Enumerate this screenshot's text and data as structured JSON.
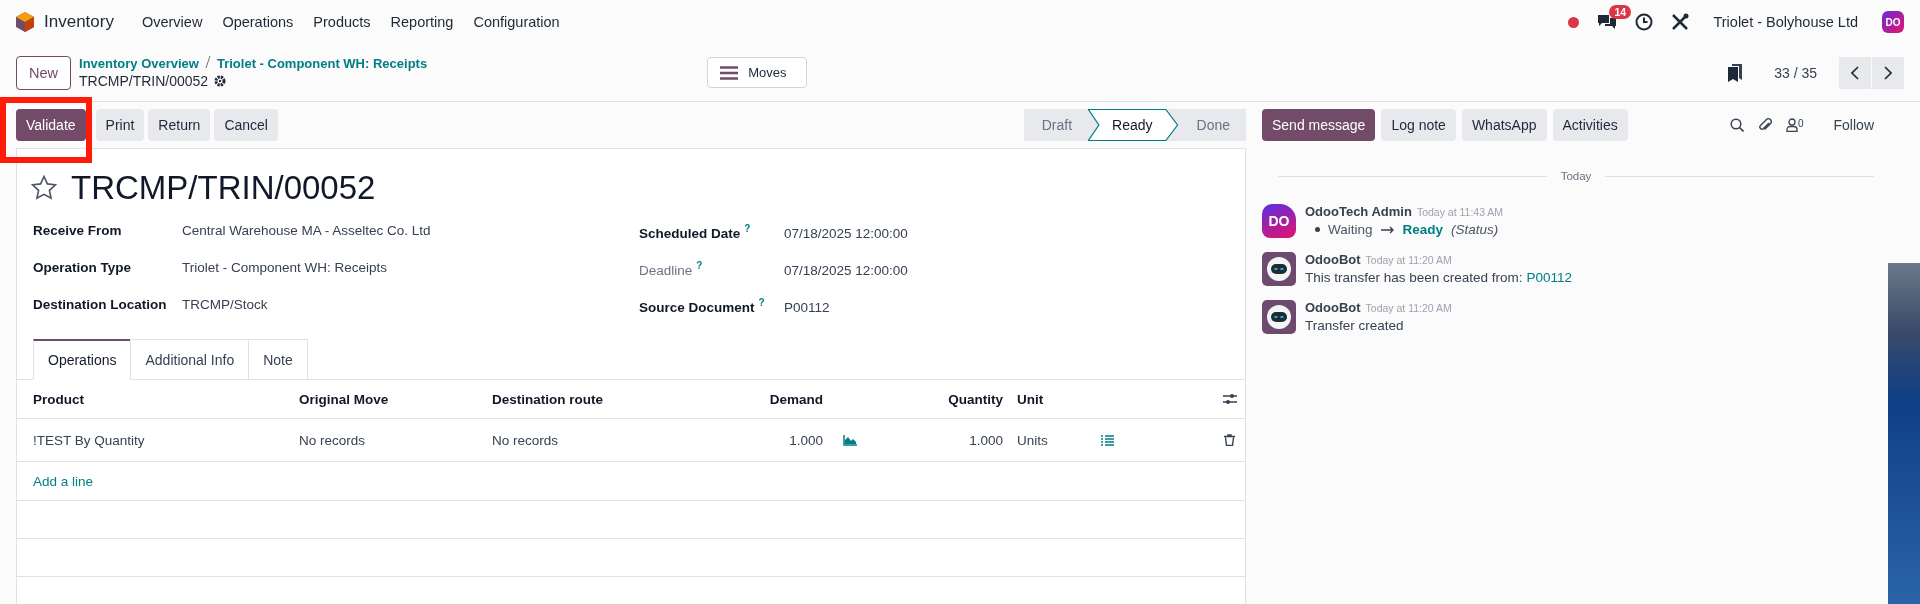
{
  "navbar": {
    "app_name": "Inventory",
    "menu": [
      "Overview",
      "Operations",
      "Products",
      "Reporting",
      "Configuration"
    ],
    "messages_badge": "14",
    "company": "Triolet - Bolyhouse Ltd",
    "user_avatar": "DO"
  },
  "control_panel": {
    "new_button": "New",
    "breadcrumbs": [
      "Inventory Overview",
      "Triolet - Component WH: Receipts"
    ],
    "record_name": "TRCMP/TRIN/00052",
    "moves_button": "Moves",
    "pager": "33 / 35"
  },
  "actions": [
    {
      "label": "Validate",
      "kind": "primary",
      "highlighted": true
    },
    {
      "label": "Print",
      "kind": "secondary",
      "highlighted": false
    },
    {
      "label": "Return",
      "kind": "secondary",
      "highlighted": false
    },
    {
      "label": "Cancel",
      "kind": "secondary",
      "highlighted": false
    }
  ],
  "statusbar": [
    {
      "label": "Draft",
      "selected": false
    },
    {
      "label": "Ready",
      "selected": true
    },
    {
      "label": "Done",
      "selected": false
    }
  ],
  "form": {
    "title": "TRCMP/TRIN/00052",
    "starred": false,
    "fields_left": [
      {
        "label": "Receive From",
        "value": "Central Warehouse MA - Asseltec Co. Ltd",
        "muted": false
      },
      {
        "label": "Operation Type",
        "value": "Triolet - Component WH: Receipts",
        "muted": false
      },
      {
        "label": "Destination Location",
        "value": "TRCMP/Stock",
        "muted": false
      }
    ],
    "fields_right": [
      {
        "label": "Scheduled Date",
        "help": "?",
        "value": "07/18/2025 12:00:00",
        "muted": false
      },
      {
        "label": "Deadline",
        "help": "?",
        "value": "07/18/2025 12:00:00",
        "muted": true
      },
      {
        "label": "Source Document",
        "help": "?",
        "value": "P00112",
        "muted": false
      }
    ],
    "tabs": [
      {
        "label": "Operations",
        "selected": true
      },
      {
        "label": "Additional Info",
        "selected": false
      },
      {
        "label": "Note",
        "selected": false
      }
    ],
    "table": {
      "columns": [
        "Product",
        "Original Move",
        "Destination route",
        "Demand",
        "Quantity",
        "Unit"
      ],
      "rows": [
        {
          "product": "!TEST By Quantity",
          "original_move": "No records",
          "destination_route": "No records",
          "demand": "1.000",
          "quantity": "1.000",
          "unit": "Units"
        }
      ],
      "add_line": "Add a line"
    }
  },
  "chatter": {
    "buttons": [
      {
        "label": "Send message",
        "kind": "primary"
      },
      {
        "label": "Log note",
        "kind": "secondary"
      },
      {
        "label": "WhatsApp",
        "kind": "secondary"
      },
      {
        "label": "Activities",
        "kind": "secondary"
      }
    ],
    "followers_count": "0",
    "follow": "Follow",
    "divider": "Today",
    "messages": [
      {
        "kind": "tracking",
        "avatar": {
          "kind": "logo",
          "text": "DO"
        },
        "author": "OdooTech Admin",
        "time": "Today at 11:43 AM",
        "old_value": "Waiting",
        "new_value": "Ready",
        "field": "(Status)"
      },
      {
        "kind": "text",
        "avatar": {
          "kind": "bot"
        },
        "author": "OdooBot",
        "time": "Today at 11:20 AM",
        "text": "This transfer has been created from:",
        "link": "P00112"
      },
      {
        "kind": "text",
        "avatar": {
          "kind": "bot"
        },
        "author": "OdooBot",
        "time": "Today at 11:20 AM",
        "text": "Transfer created"
      }
    ]
  }
}
